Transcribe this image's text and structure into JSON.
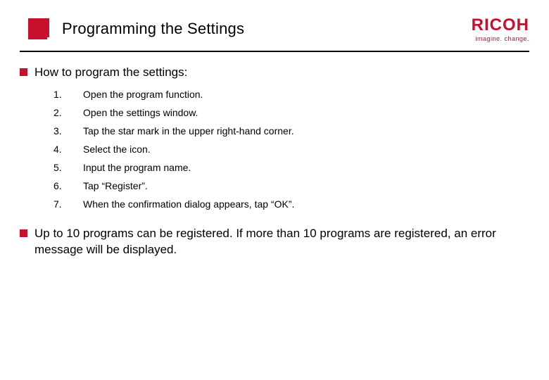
{
  "header": {
    "title": "Programming the Settings",
    "logo_main": "RICOH",
    "logo_tag": "imagine. change."
  },
  "section": {
    "heading": "How to program the settings:",
    "steps": [
      {
        "num": "1.",
        "text": "Open the program function."
      },
      {
        "num": "2.",
        "text": "Open the settings window."
      },
      {
        "num": "3.",
        "text": "Tap the star mark in the upper right-hand corner."
      },
      {
        "num": "4.",
        "text": "Select the icon."
      },
      {
        "num": "5.",
        "text": "Input the program name."
      },
      {
        "num": "6.",
        "text": "Tap “Register”."
      },
      {
        "num": "7.",
        "text": "When the confirmation dialog appears, tap “OK”."
      }
    ],
    "note": "Up to 10 programs can be registered. If more than 10 programs are registered, an error message will be displayed."
  },
  "colors": {
    "brand": "#c8102e"
  }
}
